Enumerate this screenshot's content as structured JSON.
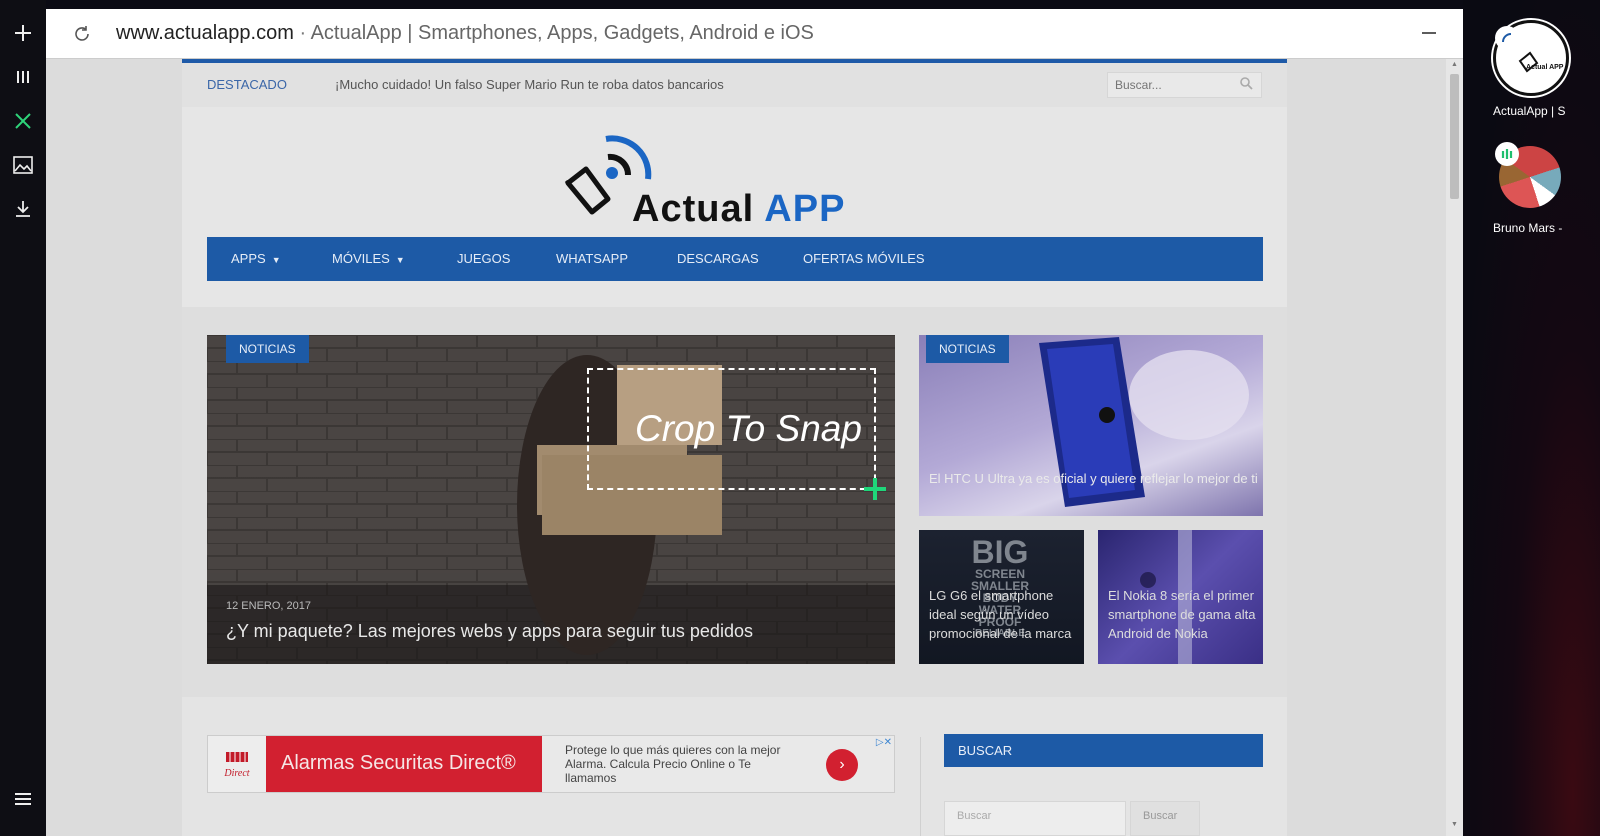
{
  "left_bar": {
    "add_label": "+",
    "columns_label": "|||",
    "close_label": "×",
    "menu_label": "≡"
  },
  "right_panel": {
    "items": [
      {
        "label": "ActualApp | S"
      },
      {
        "label": "Bruno Mars -"
      }
    ]
  },
  "browser": {
    "url": "www.actualapp.com",
    "separator": "·",
    "title": "ActualApp | Smartphones, Apps, Gadgets, Android e iOS"
  },
  "site": {
    "topbar": {
      "featured_label": "DESTACADO",
      "ticker": "¡Mucho cuidado! Un falso Super Mario Run te roba datos bancarios",
      "search_placeholder": "Buscar..."
    },
    "logo": {
      "word1": "Actual",
      "word2": "APP"
    },
    "nav": [
      "APPS",
      "MÓVILES",
      "JUEGOS",
      "WHATSAPP",
      "DESCARGAS",
      "OFERTAS MÓVILES"
    ],
    "feature": {
      "main": {
        "tag": "NOTICIAS",
        "date": "12 ENERO, 2017",
        "title": "¿Y mi paquete? Las mejores webs y apps para seguir tus pedidos"
      },
      "top_right": {
        "tag": "NOTICIAS",
        "title": "El HTC U Ultra ya es oficial y quiere reflejar lo mejor de ti"
      },
      "small_left": {
        "title": "LG G6 el smartphone ideal según un vídeo promocional de la marca",
        "overlay_big": "BIG",
        "overlay_lines": [
          "SCREEN",
          "SMALLER",
          "BODY",
          "WATER",
          "PROOF",
          "RELIABLE"
        ]
      },
      "small_right": {
        "title": "El Nokia 8 sería el primer smartphone de gama alta Android de Nokia"
      }
    },
    "ad": {
      "logo_text": "Direct",
      "headline": "Alarmas Securitas Direct®",
      "body": "Protege lo que más quieres con la mejor Alarma. Calcula Precio Online o Te llamamos",
      "arrow": "›",
      "choices": "▷✕"
    },
    "sidebar": {
      "widget_title": "BUSCAR",
      "input_placeholder": "Buscar",
      "button_label": "Buscar"
    }
  },
  "crop_overlay": {
    "label": "Crop To Snap"
  },
  "colors": {
    "site_blue": "#1d5aa6",
    "logo_blue": "#1b66c4",
    "ad_red": "#d22030",
    "crop_green": "#1fd67a"
  }
}
